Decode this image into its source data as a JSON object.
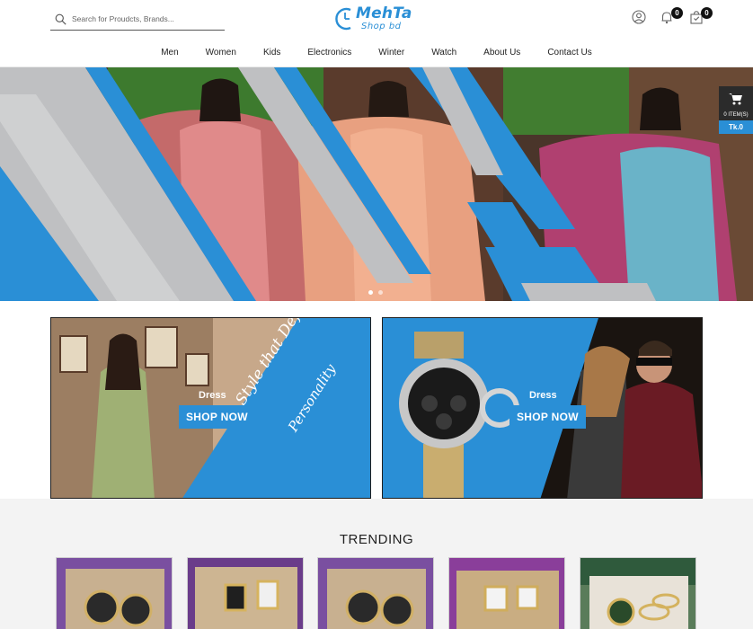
{
  "search": {
    "placeholder": "Search for Proudcts, Brands..."
  },
  "logo": {
    "brand": "MehTa",
    "sub": "Shop bd"
  },
  "header_icons": {
    "account": "user-icon",
    "notifications": {
      "icon": "bell-icon",
      "count": "0"
    },
    "bag": {
      "icon": "bag-icon",
      "count": "0"
    }
  },
  "nav": [
    "Men",
    "Women",
    "Kids",
    "Electronics",
    "Winter",
    "Watch",
    "About Us",
    "Contact Us"
  ],
  "cart_float": {
    "items": "0 ITEM(S)",
    "price": "Tk.0"
  },
  "banners": [
    {
      "label": "Dress",
      "button": "SHOP NOW",
      "slogan_line1": "A Style that Defines your",
      "slogan_line2": "Personality"
    },
    {
      "label": "Dress",
      "button": "SHOP NOW"
    }
  ],
  "trending": {
    "title": "TRENDING"
  },
  "colors": {
    "accent": "#2a8fd6",
    "dark": "#2b2b2b"
  }
}
